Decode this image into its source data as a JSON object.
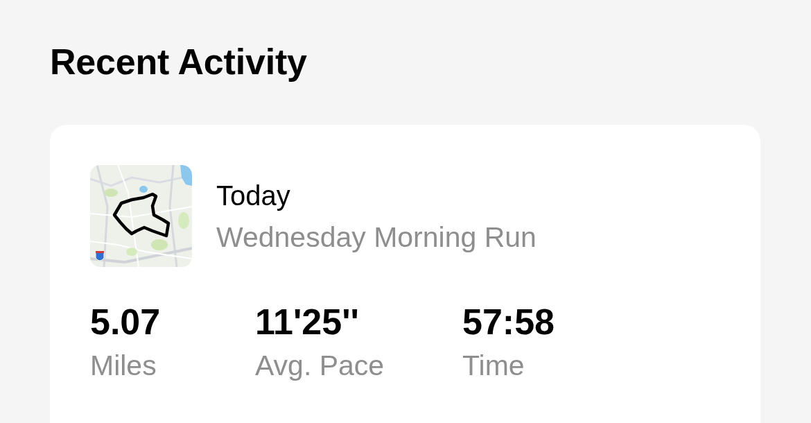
{
  "section": {
    "title": "Recent Activity"
  },
  "activity_card": {
    "date": "Today",
    "name": "Wednesday Morning Run",
    "stats": [
      {
        "value": "5.07",
        "label": "Miles"
      },
      {
        "value": "11'25''",
        "label": "Avg. Pace"
      },
      {
        "value": "57:58",
        "label": "Time"
      }
    ]
  }
}
